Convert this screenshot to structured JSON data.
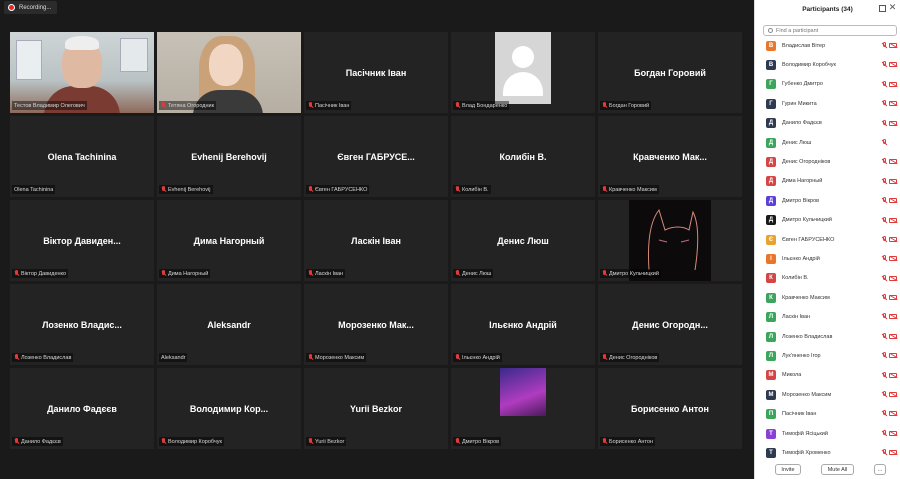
{
  "recording": {
    "label": "Recording..."
  },
  "tiles": [
    {
      "type": "photo-man",
      "label": "Тестов Владимир Олегович",
      "muted": false,
      "active": true
    },
    {
      "type": "photo-woman",
      "label": "Тетяна Огородник",
      "muted": true
    },
    {
      "type": "name",
      "center": "Пасічник Іван",
      "label": "Пасічник Іван",
      "muted": true
    },
    {
      "type": "default-avatar",
      "label": "Влад Бондаренко",
      "muted": true
    },
    {
      "type": "name",
      "center": "Богдан Горовий",
      "label": "Богдан Горовий",
      "muted": true
    },
    {
      "type": "name",
      "center": "Olena Tachinina",
      "label": "Olena Tachinina",
      "muted": false
    },
    {
      "type": "name",
      "center": "Evhenij Berehovij",
      "label": "Evhenij Berehovij",
      "muted": true
    },
    {
      "type": "name",
      "center": "Євген ГАБРУСЕ...",
      "label": "Євген ГАБРУСЕНКО",
      "muted": true
    },
    {
      "type": "name",
      "center": "Колибін В.",
      "label": "Колибін В.",
      "muted": true
    },
    {
      "type": "name",
      "center": "Кравченко Мак...",
      "label": "Кравченко Максим",
      "muted": true
    },
    {
      "type": "name",
      "center": "Віктор Давиден...",
      "label": "Віктор Давиденко",
      "muted": true
    },
    {
      "type": "name",
      "center": "Дима Нагорный",
      "label": "Дима Нагорный",
      "muted": true
    },
    {
      "type": "name",
      "center": "Ласкін Іван",
      "label": "Ласкін Іван",
      "muted": true
    },
    {
      "type": "name",
      "center": "Денис Люш",
      "label": "Денис Люш",
      "muted": true
    },
    {
      "type": "cat",
      "label": "Дмитро Кульчицкий",
      "muted": true
    },
    {
      "type": "name",
      "center": "Лозенко Владис...",
      "label": "Лозенко Владислав",
      "muted": true
    },
    {
      "type": "name",
      "center": "Aleksandr",
      "label": "Aleksandr",
      "muted": false
    },
    {
      "type": "name",
      "center": "Морозенко Мак...",
      "label": "Морозенко Максим",
      "muted": true
    },
    {
      "type": "name",
      "center": "Ільєнко Андрій",
      "label": "Ільєнко Андрій",
      "muted": true
    },
    {
      "type": "name",
      "center": "Денис Огородн...",
      "label": "Денис Огородніков",
      "muted": true
    },
    {
      "type": "name",
      "center": "Данило Фадєєв",
      "label": "Данило Фадєєв",
      "muted": true
    },
    {
      "type": "name",
      "center": "Володимир Кор...",
      "label": "Володимир Коробчук",
      "muted": true
    },
    {
      "type": "name",
      "center": "Yurii Bezkor",
      "label": "Yurii Bezkor",
      "muted": true
    },
    {
      "type": "anime",
      "label": "Дмитро Вікров",
      "muted": true
    },
    {
      "type": "name",
      "center": "Борисенко Антон",
      "label": "Борисенко Антон",
      "muted": true
    }
  ],
  "panel": {
    "title": "Participants (34)",
    "search_placeholder": "Find a participant",
    "invite_label": "Invite",
    "mute_all_label": "Mute All",
    "more_label": "...",
    "participants": [
      {
        "initial": "В",
        "color": "#e8772e",
        "name": "Владислав Вітер",
        "mic": true,
        "cam": true
      },
      {
        "initial": "В",
        "color": "#2d3a4f",
        "name": "Володимир Коробчук",
        "mic": true,
        "cam": true
      },
      {
        "initial": "Г",
        "color": "#3aa55b",
        "name": "Губенко Дмитро",
        "mic": true,
        "cam": true
      },
      {
        "initial": "Г",
        "color": "#2d3a4f",
        "name": "Гурин Микита",
        "mic": true,
        "cam": true
      },
      {
        "initial": "Д",
        "color": "#2d3a4f",
        "name": "Данило Фадєєв",
        "mic": true,
        "cam": true
      },
      {
        "initial": "Д",
        "color": "#3aa55b",
        "name": "Денис Люш",
        "mic": true,
        "cam": false
      },
      {
        "initial": "Д",
        "color": "#d64545",
        "name": "Денис Огородніков",
        "mic": true,
        "cam": true
      },
      {
        "initial": "Д",
        "color": "#d64545",
        "name": "Дима Нагорный",
        "mic": true,
        "cam": true
      },
      {
        "initial": "Д",
        "color": "#5b3fd6",
        "name": "Дмитро Вікров",
        "mic": true,
        "cam": true
      },
      {
        "initial": "Д",
        "color": "#1a1a1a",
        "name": "Дмитро Кульчицкий",
        "mic": true,
        "cam": true
      },
      {
        "initial": "Є",
        "color": "#e8a32e",
        "name": "Євген ГАБРУСЕНКО",
        "mic": true,
        "cam": true
      },
      {
        "initial": "І",
        "color": "#e8772e",
        "name": "Ільєнко Андрій",
        "mic": true,
        "cam": true
      },
      {
        "initial": "К",
        "color": "#d64545",
        "name": "Колибін В.",
        "mic": true,
        "cam": true
      },
      {
        "initial": "К",
        "color": "#3aa55b",
        "name": "Кравченко Максим",
        "mic": true,
        "cam": true
      },
      {
        "initial": "Л",
        "color": "#3aa55b",
        "name": "Ласкін Іван",
        "mic": true,
        "cam": true
      },
      {
        "initial": "Л",
        "color": "#3aa55b",
        "name": "Лозенко Владислав",
        "mic": true,
        "cam": true
      },
      {
        "initial": "Л",
        "color": "#3aa55b",
        "name": "Лук'яненко Ігор",
        "mic": true,
        "cam": true
      },
      {
        "initial": "М",
        "color": "#d64545",
        "name": "Микола",
        "mic": true,
        "cam": true
      },
      {
        "initial": "М",
        "color": "#2d3a4f",
        "name": "Морозенко Максим",
        "mic": true,
        "cam": true
      },
      {
        "initial": "П",
        "color": "#3aa55b",
        "name": "Пасічник Іван",
        "mic": true,
        "cam": true
      },
      {
        "initial": "Т",
        "color": "#8a3fd6",
        "name": "Тимофій Ясіцький",
        "mic": true,
        "cam": true
      },
      {
        "initial": "Т",
        "color": "#2d3a4f",
        "name": "Тимофій Хроменко",
        "mic": true,
        "cam": true
      }
    ]
  }
}
